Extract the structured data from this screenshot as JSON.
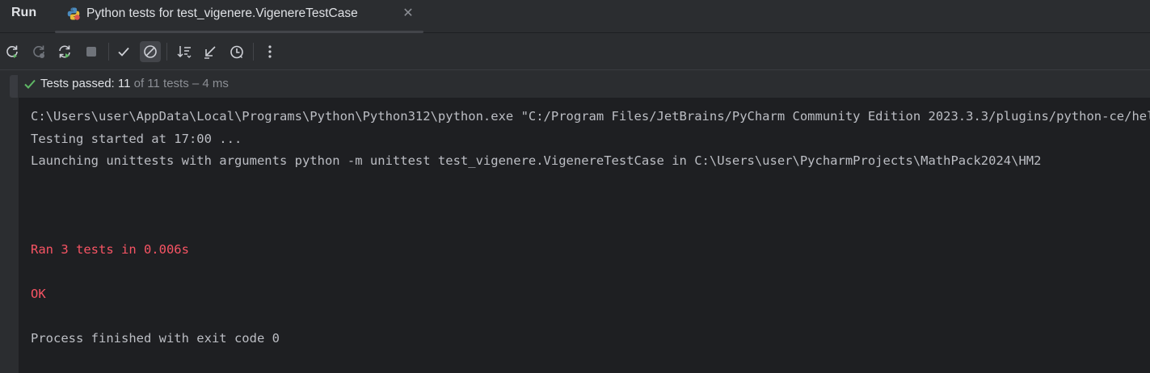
{
  "header": {
    "run_label": "Run",
    "tab": {
      "title": "Python tests for test_vigenere.VigenereTestCase",
      "icon": "python-tests-icon",
      "close_icon": "close-icon"
    }
  },
  "toolbar": {
    "buttons": [
      {
        "name": "rerun-icon"
      },
      {
        "name": "rerun-failed-icon"
      },
      {
        "name": "toggle-auto-test-icon"
      },
      {
        "name": "stop-icon"
      },
      {
        "name": "show-passed-icon"
      },
      {
        "name": "show-ignored-icon"
      },
      {
        "name": "sort-icon"
      },
      {
        "name": "collapse-icon"
      },
      {
        "name": "history-icon"
      },
      {
        "name": "more-icon"
      }
    ]
  },
  "status": {
    "label": "Tests passed: 11",
    "detail": " of 11 tests – 4 ms",
    "color": "#5fb865"
  },
  "console": {
    "lines": [
      "C:\\Users\\user\\AppData\\Local\\Programs\\Python\\Python312\\python.exe \"C:/Program Files/JetBrains/PyCharm Community Edition 2023.3.3/plugins/python-ce/helpers/pycharm/_jb_unittest_runner.py\"",
      "Testing started at 17:00 ...",
      "Launching unittests with arguments python -m unittest test_vigenere.VigenereTestCase in C:\\Users\\user\\PycharmProjects\\MathPack2024\\HM2",
      "Ran 3 tests in 0.006s",
      "OK",
      "Process finished with exit code 0"
    ],
    "error_color": "#f75464"
  }
}
